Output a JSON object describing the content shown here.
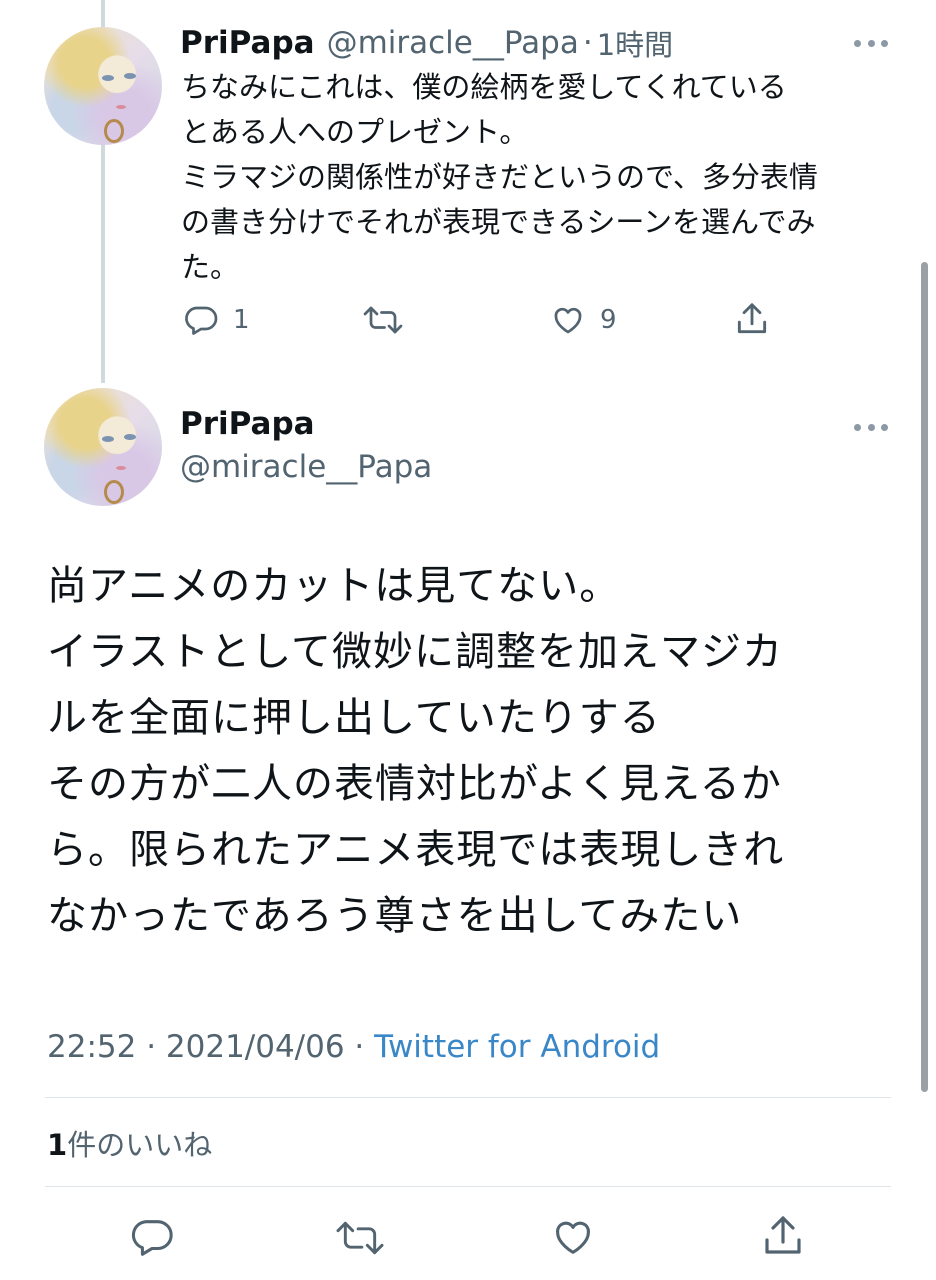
{
  "reply_tweet": {
    "name": "PriPapa",
    "handle": "@miracle__Papa",
    "time": "1時間",
    "text_lines": [
      "ちなみにこれは、僕の絵柄を愛してくれている",
      "とある人へのプレゼント。",
      "ミラマジの関係性が好きだというので、多分表情",
      "の書き分けでそれが表現できるシーンを選んでみ",
      "た。"
    ],
    "reply_count": "1",
    "like_count": "9"
  },
  "main_tweet": {
    "name": "PriPapa",
    "handle": "@miracle__Papa",
    "text_lines": [
      "尚アニメのカットは見てない。",
      "イラストとして微妙に調整を加えマジカ",
      "ルを全面に押し出していたりする",
      "その方が二人の表情対比がよく見えるか",
      "ら。限られたアニメ表現では表現しきれ",
      "なかったであろう尊さを出してみたい"
    ],
    "timestamp": "22:52 · 2021/04/06 · ",
    "source": "Twitter for Android",
    "likes_count": "1",
    "likes_label": "件のいいね"
  },
  "icons": {
    "reply": "reply-icon",
    "retweet": "retweet-icon",
    "like": "heart-icon",
    "share": "share-icon",
    "more": "more-icon"
  },
  "colors": {
    "text": "#0f1419",
    "secondary": "#536471",
    "link": "#3a87c8",
    "icon": "#536471"
  }
}
